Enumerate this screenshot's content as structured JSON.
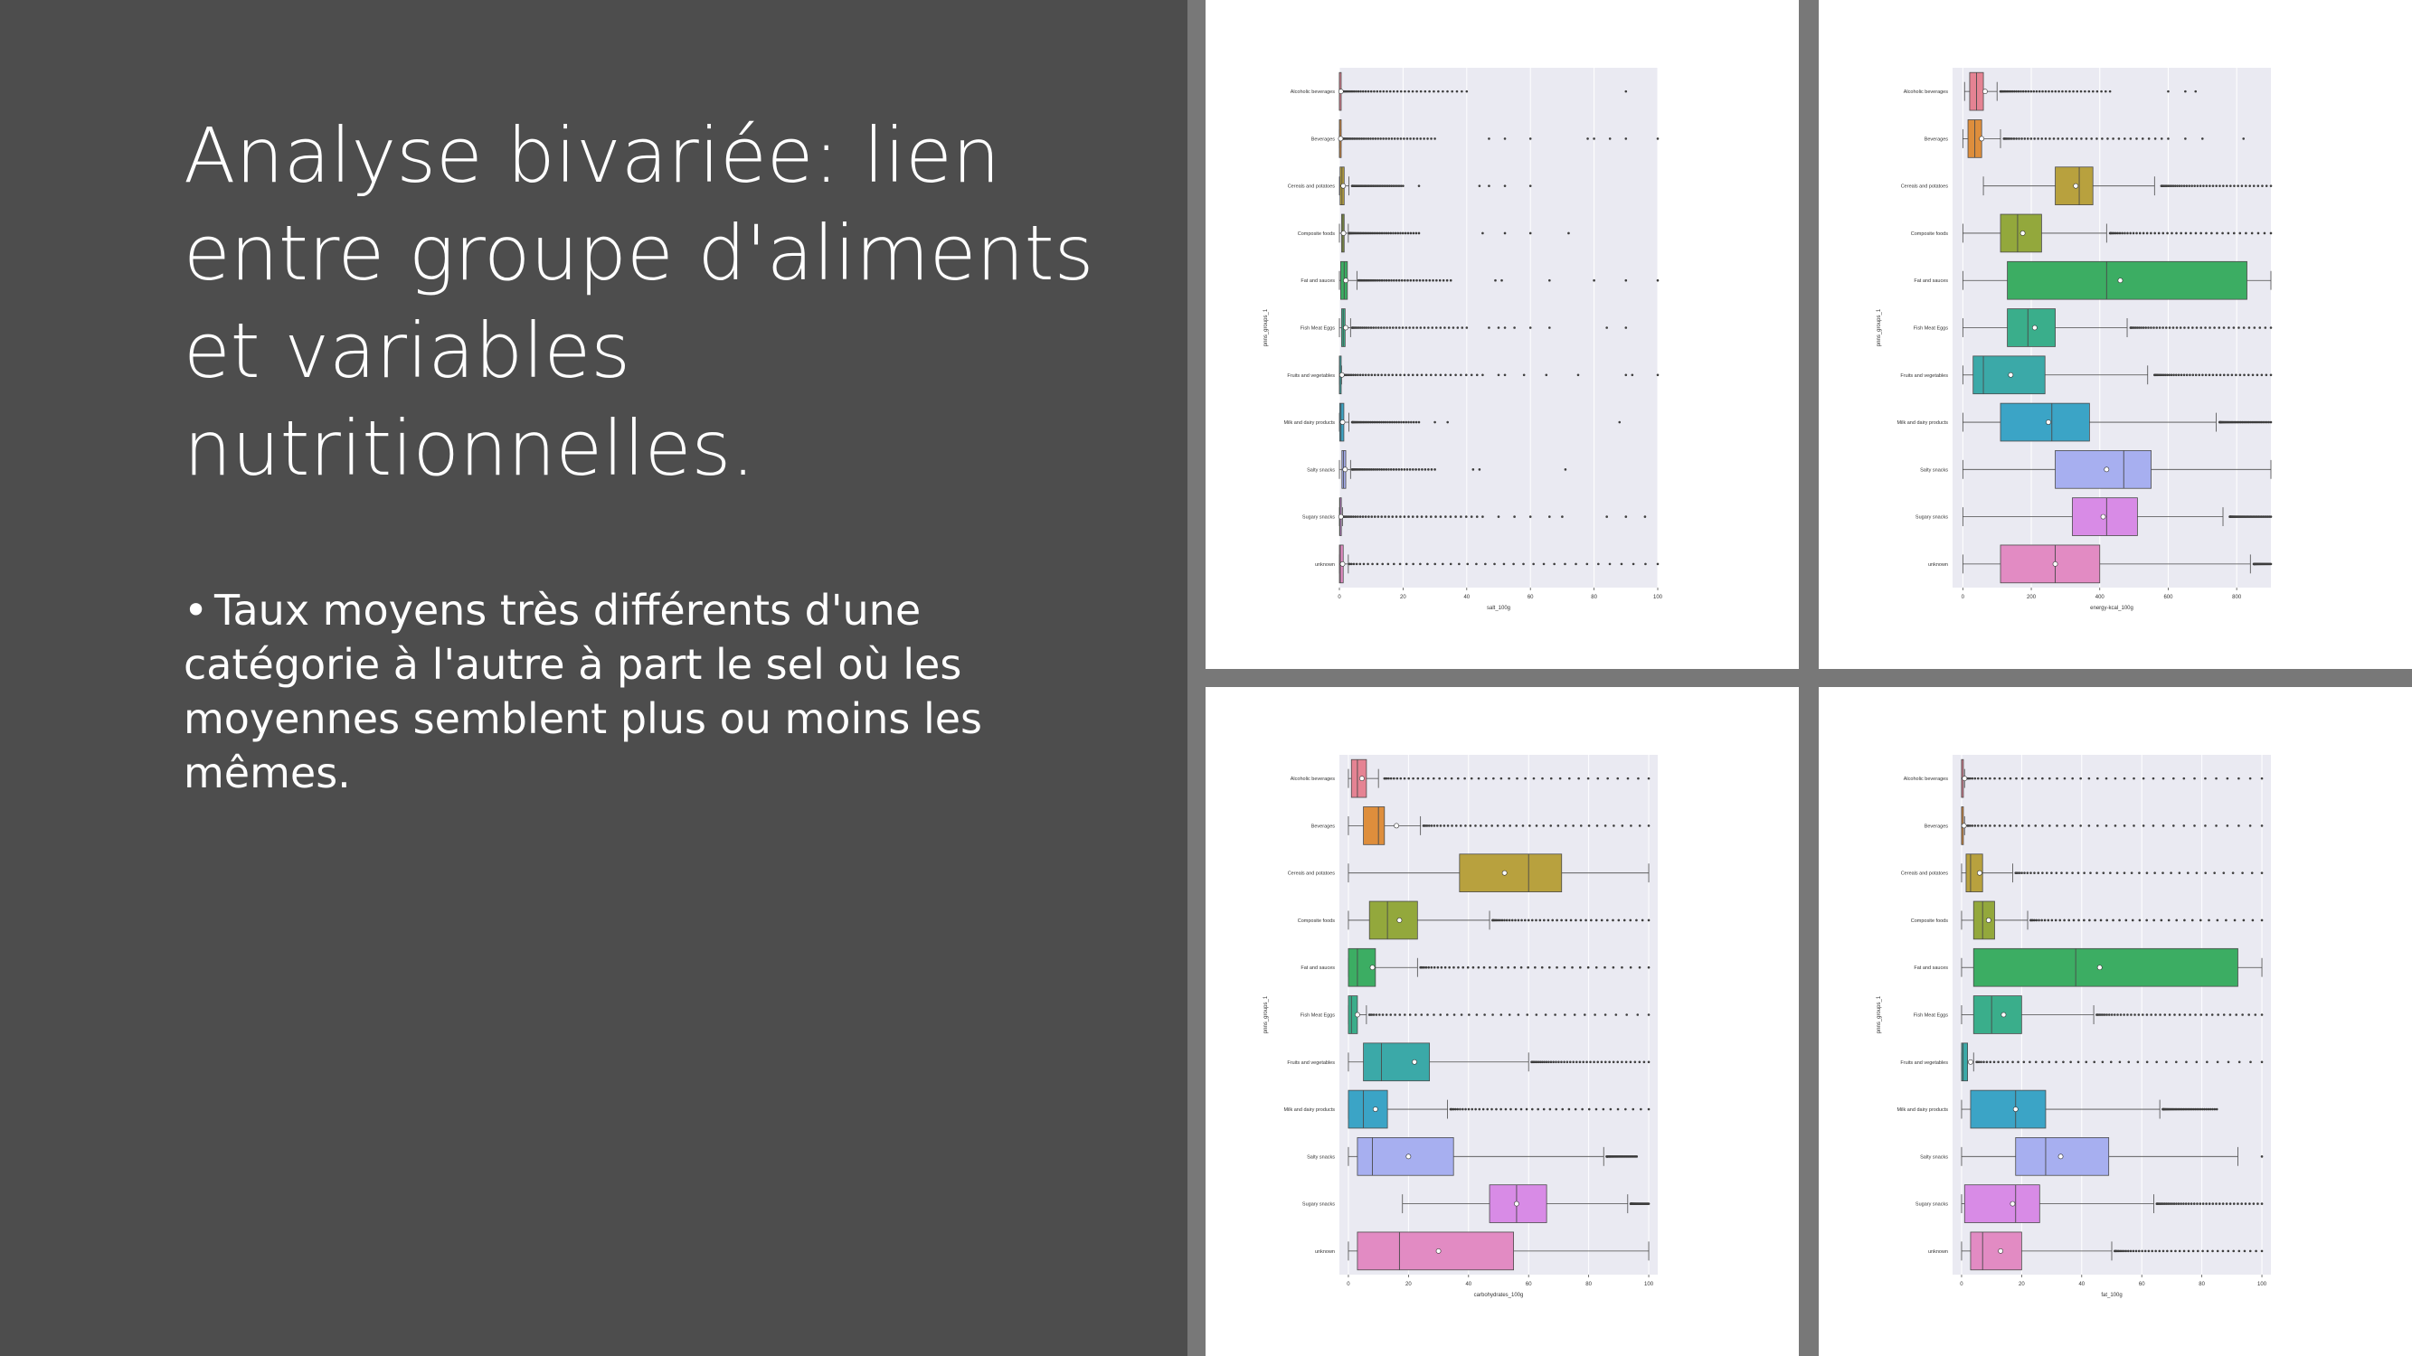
{
  "slide": {
    "title": "Analyse bivariée: lien entre groupe d'aliments et variables nutritionnelles.",
    "bullets": [
      "Taux moyens très différents d'une catégorie à l'autre à part le sel où les moyennes semblent plus ou moins les mêmes."
    ]
  },
  "colors": {
    "left_background": "#4d4d4d",
    "separator": "#787878",
    "plot_background": "#eaeaf2",
    "box_palette": [
      "#e58393",
      "#de8e3c",
      "#b8a13e",
      "#93a83c",
      "#3cad63",
      "#3aae8b",
      "#3ba9a8",
      "#3ba4c6",
      "#a7aff0",
      "#d88be6",
      "#e28bc3"
    ]
  },
  "chart_data": [
    {
      "type": "boxplot",
      "orientation": "horizontal",
      "xlabel": "salt_100g",
      "ylabel": "pnns_groups_1",
      "xlim": [
        0,
        100
      ],
      "xticks": [
        0,
        20,
        40,
        60,
        80,
        100
      ],
      "grid": true,
      "categories": [
        "Alcoholic beverages",
        "Beverages",
        "Cereals and potatoes",
        "Composite foods",
        "Fat and sauces",
        "Fish Meat Eggs",
        "Fruits and vegetables",
        "Milk and dairy products",
        "Salty snacks",
        "Sugary snacks",
        "unknown"
      ],
      "boxes": [
        {
          "q1": 0,
          "median": 0,
          "q3": 0.1,
          "mean": 0.5,
          "whisker_low": 0,
          "whisker_high": 0.3,
          "outlier_range": [
            1,
            40
          ],
          "far_outliers": [
            90
          ]
        },
        {
          "q1": 0,
          "median": 0.05,
          "q3": 0.2,
          "mean": 0.4,
          "whisker_low": 0,
          "whisker_high": 0.5,
          "outlier_range": [
            1,
            30
          ],
          "far_outliers": [
            47,
            52,
            60,
            78,
            80,
            85,
            90,
            100
          ]
        },
        {
          "q1": 0.2,
          "median": 0.8,
          "q3": 1.5,
          "mean": 1.2,
          "whisker_low": 0,
          "whisker_high": 3,
          "outlier_range": [
            4,
            20
          ],
          "far_outliers": [
            25,
            44,
            47,
            52,
            60
          ]
        },
        {
          "q1": 0.7,
          "median": 1.1,
          "q3": 1.5,
          "mean": 1.3,
          "whisker_low": 0,
          "whisker_high": 2.8,
          "outlier_range": [
            3,
            25
          ],
          "far_outliers": [
            45,
            52,
            60,
            72
          ]
        },
        {
          "q1": 0.4,
          "median": 1.5,
          "q3": 2.5,
          "mean": 2,
          "whisker_low": 0,
          "whisker_high": 5.5,
          "outlier_range": [
            6,
            35
          ],
          "far_outliers": [
            49,
            51,
            66,
            80,
            90,
            100
          ]
        },
        {
          "q1": 0.7,
          "median": 1.2,
          "q3": 1.8,
          "mean": 2,
          "whisker_low": 0,
          "whisker_high": 3.5,
          "outlier_range": [
            4,
            40
          ],
          "far_outliers": [
            47,
            50,
            52,
            55,
            60,
            66,
            84,
            90
          ]
        },
        {
          "q1": 0,
          "median": 0.05,
          "q3": 0.3,
          "mean": 0.8,
          "whisker_low": 0,
          "whisker_high": 0.7,
          "outlier_range": [
            1,
            45
          ],
          "far_outliers": [
            50,
            52,
            58,
            65,
            75,
            90,
            92,
            100
          ]
        },
        {
          "q1": 0.1,
          "median": 0.5,
          "q3": 1.4,
          "mean": 1,
          "whisker_low": 0,
          "whisker_high": 3,
          "outlier_range": [
            4,
            25
          ],
          "far_outliers": [
            30,
            34,
            88
          ]
        },
        {
          "q1": 0.8,
          "median": 1.3,
          "q3": 2,
          "mean": 1.8,
          "whisker_low": 0,
          "whisker_high": 3.5,
          "outlier_range": [
            4,
            30
          ],
          "far_outliers": [
            42,
            44,
            71
          ]
        },
        {
          "q1": 0.05,
          "median": 0.2,
          "q3": 0.4,
          "mean": 0.5,
          "whisker_low": 0,
          "whisker_high": 1,
          "outlier_range": [
            1,
            45
          ],
          "far_outliers": [
            50,
            55,
            60,
            66,
            70,
            84,
            90,
            96
          ]
        },
        {
          "q1": 0,
          "median": 0.3,
          "q3": 1.2,
          "mean": 1,
          "whisker_low": 0,
          "whisker_high": 2.8,
          "outlier_range": [
            3,
            100
          ],
          "far_outliers": []
        }
      ]
    },
    {
      "type": "boxplot",
      "orientation": "horizontal",
      "xlabel": "energy-kcal_100g",
      "ylabel": "pnns_groups_1",
      "xlim": [
        -30,
        900
      ],
      "xticks": [
        0,
        200,
        400,
        600,
        800
      ],
      "grid": true,
      "categories": [
        "Alcoholic beverages",
        "Beverages",
        "Cereals and potatoes",
        "Composite foods",
        "Fat and sauces",
        "Fish Meat Eggs",
        "Fruits and vegetables",
        "Milk and dairy products",
        "Salty snacks",
        "Sugary snacks",
        "unknown"
      ],
      "boxes": [
        {
          "q1": 20,
          "median": 40,
          "q3": 60,
          "mean": 65,
          "whisker_low": 5,
          "whisker_high": 100,
          "outlier_range": [
            110,
            430
          ],
          "far_outliers": [
            600,
            650,
            680
          ]
        },
        {
          "q1": 15,
          "median": 35,
          "q3": 55,
          "mean": 55,
          "whisker_low": 0,
          "whisker_high": 110,
          "outlier_range": [
            120,
            600
          ],
          "far_outliers": [
            650,
            700,
            820
          ]
        },
        {
          "q1": 270,
          "median": 340,
          "q3": 380,
          "mean": 330,
          "whisker_low": 60,
          "whisker_high": 560,
          "outlier_range": [
            580,
            900
          ],
          "far_outliers": []
        },
        {
          "q1": 110,
          "median": 160,
          "q3": 230,
          "mean": 175,
          "whisker_low": 0,
          "whisker_high": 420,
          "outlier_range": [
            430,
            900
          ],
          "far_outliers": []
        },
        {
          "q1": 130,
          "median": 420,
          "q3": 830,
          "mean": 460,
          "whisker_low": 0,
          "whisker_high": 900,
          "outlier_range": [],
          "far_outliers": []
        },
        {
          "q1": 130,
          "median": 190,
          "q3": 270,
          "mean": 210,
          "whisker_low": 0,
          "whisker_high": 480,
          "outlier_range": [
            490,
            900
          ],
          "far_outliers": []
        },
        {
          "q1": 30,
          "median": 60,
          "q3": 240,
          "mean": 140,
          "whisker_low": 0,
          "whisker_high": 540,
          "outlier_range": [
            560,
            900
          ],
          "far_outliers": []
        },
        {
          "q1": 110,
          "median": 260,
          "q3": 370,
          "mean": 250,
          "whisker_low": 0,
          "whisker_high": 740,
          "outlier_range": [
            750,
            900
          ],
          "far_outliers": []
        },
        {
          "q1": 270,
          "median": 470,
          "q3": 550,
          "mean": 420,
          "whisker_low": 0,
          "whisker_high": 900,
          "outlier_range": [],
          "far_outliers": []
        },
        {
          "q1": 320,
          "median": 420,
          "q3": 510,
          "mean": 410,
          "whisker_low": 0,
          "whisker_high": 760,
          "outlier_range": [
            780,
            900
          ],
          "far_outliers": []
        },
        {
          "q1": 110,
          "median": 270,
          "q3": 400,
          "mean": 270,
          "whisker_low": 0,
          "whisker_high": 840,
          "outlier_range": [
            850,
            900
          ],
          "far_outliers": []
        }
      ]
    },
    {
      "type": "boxplot",
      "orientation": "horizontal",
      "xlabel": "carbohydrates_100g",
      "ylabel": "pnns_groups_1",
      "xlim": [
        -3,
        103
      ],
      "xticks": [
        0,
        20,
        40,
        60,
        80,
        100
      ],
      "grid": true,
      "categories": [
        "Alcoholic beverages",
        "Beverages",
        "Cereals and potatoes",
        "Composite foods",
        "Fat and sauces",
        "Fish Meat Eggs",
        "Fruits and vegetables",
        "Milk and dairy products",
        "Salty snacks",
        "Sugary snacks",
        "unknown"
      ],
      "boxes": [
        {
          "q1": 1,
          "median": 3,
          "q3": 6,
          "mean": 4.5,
          "whisker_low": 0,
          "whisker_high": 10,
          "outlier_range": [
            12,
            100
          ],
          "far_outliers": []
        },
        {
          "q1": 5,
          "median": 10,
          "q3": 12,
          "mean": 16,
          "whisker_low": 0,
          "whisker_high": 24,
          "outlier_range": [
            25,
            100
          ],
          "far_outliers": []
        },
        {
          "q1": 37,
          "median": 60,
          "q3": 71,
          "mean": 52,
          "whisker_low": 0,
          "whisker_high": 100,
          "outlier_range": [],
          "far_outliers": []
        },
        {
          "q1": 7,
          "median": 13,
          "q3": 23,
          "mean": 17,
          "whisker_low": 0,
          "whisker_high": 47,
          "outlier_range": [
            48,
            100
          ],
          "far_outliers": []
        },
        {
          "q1": 0,
          "median": 3,
          "q3": 9,
          "mean": 8,
          "whisker_low": 0,
          "whisker_high": 23,
          "outlier_range": [
            24,
            100
          ],
          "far_outliers": []
        },
        {
          "q1": 0,
          "median": 1,
          "q3": 3,
          "mean": 3,
          "whisker_low": 0,
          "whisker_high": 6,
          "outlier_range": [
            7,
            100
          ],
          "far_outliers": []
        },
        {
          "q1": 5,
          "median": 11,
          "q3": 27,
          "mean": 22,
          "whisker_low": 0,
          "whisker_high": 60,
          "outlier_range": [
            61,
            100
          ],
          "far_outliers": []
        },
        {
          "q1": 0,
          "median": 5,
          "q3": 13,
          "mean": 9,
          "whisker_low": 0,
          "whisker_high": 33,
          "outlier_range": [
            34,
            100
          ],
          "far_outliers": []
        },
        {
          "q1": 3,
          "median": 8,
          "q3": 35,
          "mean": 20,
          "whisker_low": 0,
          "whisker_high": 85,
          "outlier_range": [
            86,
            96
          ],
          "far_outliers": []
        },
        {
          "q1": 47,
          "median": 56,
          "q3": 66,
          "mean": 56,
          "whisker_low": 18,
          "whisker_high": 93,
          "outlier_range": [
            94,
            100
          ],
          "far_outliers": []
        },
        {
          "q1": 3,
          "median": 17,
          "q3": 55,
          "mean": 30,
          "whisker_low": 0,
          "whisker_high": 100,
          "outlier_range": [],
          "far_outliers": []
        }
      ]
    },
    {
      "type": "boxplot",
      "orientation": "horizontal",
      "xlabel": "fat_100g",
      "ylabel": "pnns_groups_1",
      "xlim": [
        -3,
        103
      ],
      "xticks": [
        0,
        20,
        40,
        60,
        80,
        100
      ],
      "grid": true,
      "categories": [
        "Alcoholic beverages",
        "Beverages",
        "Cereals and potatoes",
        "Composite foods",
        "Fat and sauces",
        "Fish Meat Eggs",
        "Fruits and vegetables",
        "Milk and dairy products",
        "Salty snacks",
        "Sugary snacks",
        "unknown"
      ],
      "boxes": [
        {
          "q1": 0,
          "median": 0,
          "q3": 0.5,
          "mean": 1,
          "whisker_low": 0,
          "whisker_high": 1,
          "outlier_range": [
            2,
            100
          ],
          "far_outliers": []
        },
        {
          "q1": 0,
          "median": 0,
          "q3": 0.5,
          "mean": 0.8,
          "whisker_low": 0,
          "whisker_high": 1,
          "outlier_range": [
            2,
            100
          ],
          "far_outliers": []
        },
        {
          "q1": 1.5,
          "median": 3,
          "q3": 7,
          "mean": 6,
          "whisker_low": 0,
          "whisker_high": 17,
          "outlier_range": [
            18,
            100
          ],
          "far_outliers": []
        },
        {
          "q1": 4,
          "median": 7,
          "q3": 11,
          "mean": 9,
          "whisker_low": 0,
          "whisker_high": 22,
          "outlier_range": [
            23,
            100
          ],
          "far_outliers": []
        },
        {
          "q1": 4,
          "median": 38,
          "q3": 92,
          "mean": 46,
          "whisker_low": 0,
          "whisker_high": 100,
          "outlier_range": [],
          "far_outliers": []
        },
        {
          "q1": 4,
          "median": 10,
          "q3": 20,
          "mean": 14,
          "whisker_low": 0,
          "whisker_high": 44,
          "outlier_range": [
            45,
            100
          ],
          "far_outliers": []
        },
        {
          "q1": 0,
          "median": 0.5,
          "q3": 2,
          "mean": 3,
          "whisker_low": 0,
          "whisker_high": 4,
          "outlier_range": [
            5,
            100
          ],
          "far_outliers": []
        },
        {
          "q1": 3,
          "median": 18,
          "q3": 28,
          "mean": 18,
          "whisker_low": 0,
          "whisker_high": 66,
          "outlier_range": [
            67,
            85
          ],
          "far_outliers": []
        },
        {
          "q1": 18,
          "median": 28,
          "q3": 49,
          "mean": 33,
          "whisker_low": 0,
          "whisker_high": 92,
          "outlier_range": [],
          "far_outliers": [
            100
          ]
        },
        {
          "q1": 1,
          "median": 18,
          "q3": 26,
          "mean": 17,
          "whisker_low": 0,
          "whisker_high": 64,
          "outlier_range": [
            65,
            100
          ],
          "far_outliers": []
        },
        {
          "q1": 3,
          "median": 7,
          "q3": 20,
          "mean": 13,
          "whisker_low": 0,
          "whisker_high": 50,
          "outlier_range": [
            51,
            100
          ],
          "far_outliers": []
        }
      ]
    }
  ]
}
